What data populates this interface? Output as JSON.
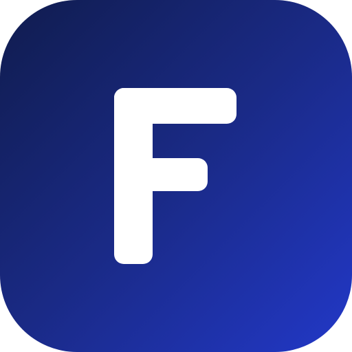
{
  "icon": {
    "name": "F app icon",
    "letter": "F",
    "colors": {
      "gradient_start": "#101c4e",
      "gradient_mid": "#1a2a86",
      "gradient_end": "#2238c8",
      "glyph": "#ffffff"
    }
  }
}
